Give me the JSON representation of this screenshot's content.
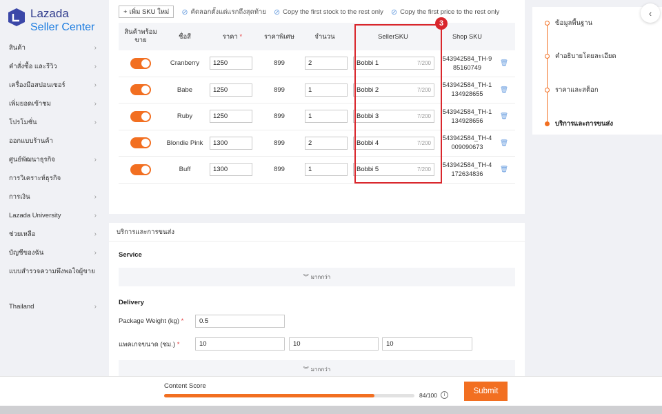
{
  "brand": {
    "name": "Lazada",
    "subtitle": "Seller Center"
  },
  "colors": {
    "accent": "#f26f21",
    "highlight": "#d9262c",
    "brand_blue": "#1a7be0"
  },
  "sidebar": {
    "items": [
      {
        "label": "สินค้า"
      },
      {
        "label": "คำสั่งซื้อ และรีวิว"
      },
      {
        "label": "เครื่องมือสปอนเซอร์"
      },
      {
        "label": "เพิ่มยอดเข้าชม"
      },
      {
        "label": "โปรโมชั่น"
      },
      {
        "label": "ออกแบบร้านค้า"
      },
      {
        "label": "ศูนย์พัฒนาธุรกิจ"
      },
      {
        "label": "การวิเคราะห์ธุรกิจ"
      },
      {
        "label": "การเงิน"
      },
      {
        "label": "Lazada University"
      },
      {
        "label": "ช่วยเหลือ"
      },
      {
        "label": "บัญชีของฉัน"
      },
      {
        "label": "แบบสำรวจความพึงพอใจผู้ขาย"
      }
    ],
    "region": "Thailand"
  },
  "toolbar": {
    "add_sku_label": "เพิ่ม SKU ใหม่",
    "copy_first_to_last": "คัดลอกตั้งแต่แรกถึงสุดท้าย",
    "copy_stock": "Copy the first stock to the rest only",
    "copy_price": "Copy the first price to the rest only"
  },
  "table": {
    "headers": {
      "available": "สินค้าพร้อมขาย",
      "name": "ชื่อสี",
      "price": "ราคา",
      "special": "ราคาพิเศษ",
      "qty": "จำนวน",
      "seller_sku": "SellerSKU",
      "shop_sku": "Shop SKU"
    },
    "rows": [
      {
        "name": "Cranberry",
        "price": "1250",
        "special": "899",
        "qty": "2",
        "seller_sku": "Bobbi 1",
        "count": "7/200",
        "shop_sku_1": "543942584_TH-9",
        "shop_sku_2": "85160749"
      },
      {
        "name": "Babe",
        "price": "1250",
        "special": "899",
        "qty": "1",
        "seller_sku": "Bobbi 2",
        "count": "7/200",
        "shop_sku_1": "543942584_TH-1",
        "shop_sku_2": "134928655"
      },
      {
        "name": "Ruby",
        "price": "1250",
        "special": "899",
        "qty": "1",
        "seller_sku": "Bobbi 3",
        "count": "7/200",
        "shop_sku_1": "543942584_TH-1",
        "shop_sku_2": "134928656"
      },
      {
        "name": "Blondie Pink",
        "price": "1300",
        "special": "899",
        "qty": "2",
        "seller_sku": "Bobbi 4",
        "count": "7/200",
        "shop_sku_1": "543942584_TH-4",
        "shop_sku_2": "009090673"
      },
      {
        "name": "Buff",
        "price": "1300",
        "special": "899",
        "qty": "1",
        "seller_sku": "Bobbi 5",
        "count": "7/200",
        "shop_sku_1": "543942584_TH-4",
        "shop_sku_2": "172634836"
      }
    ]
  },
  "annotation": {
    "number": "3"
  },
  "shipping": {
    "section_title": "บริการและการขนส่ง",
    "service_title": "Service",
    "more_label": "มากกว่า",
    "delivery_title": "Delivery",
    "weight_label": "Package Weight (kg)",
    "weight_value": "0.5",
    "dimension_label": "แพคเกจขนาด (ซม.)",
    "dim_1": "10",
    "dim_2": "10",
    "dim_3": "10"
  },
  "steps": [
    {
      "label": "ข้อมูลพื้นฐาน"
    },
    {
      "label": "คำอธิบายโดยละเอียด"
    },
    {
      "label": "ราคาและสต็อก"
    },
    {
      "label": "บริการและการขนส่ง"
    }
  ],
  "footer": {
    "score_label": "Content Score",
    "score_value": "84/100",
    "score_fraction": 0.84,
    "submit_label": "Submit"
  }
}
